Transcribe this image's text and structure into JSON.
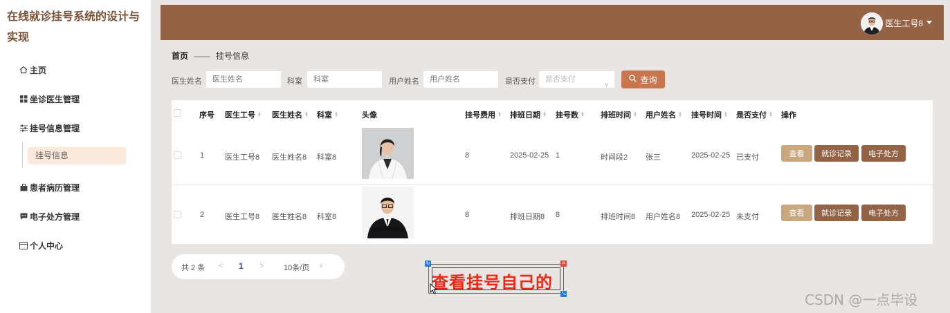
{
  "app": {
    "title": "在线就诊挂号系统的设计与实现"
  },
  "sidebar": {
    "items": [
      {
        "label": "主页",
        "icon": "home-icon"
      },
      {
        "label": "坐诊医生管理",
        "icon": "grid-icon"
      },
      {
        "label": "挂号信息管理",
        "icon": "sliders-icon"
      },
      {
        "label": "患者病历管理",
        "icon": "case-icon"
      },
      {
        "label": "电子处方管理",
        "icon": "message-icon"
      },
      {
        "label": "个人中心",
        "icon": "card-icon"
      }
    ],
    "submenu": {
      "label": "挂号信息"
    }
  },
  "header": {
    "user_name": "医生工号8",
    "bg_color": "#946346"
  },
  "breadcrumb": {
    "home": "首页",
    "separator": "——",
    "current": "挂号信息"
  },
  "search": {
    "doctor_name_label": "医生姓名",
    "doctor_name_placeholder": "医生姓名",
    "dept_label": "科室",
    "dept_placeholder": "科室",
    "user_name_label": "用户姓名",
    "user_name_placeholder": "用户姓名",
    "paid_label": "是否支付",
    "paid_placeholder": "是否支付",
    "button": "查询",
    "button_color": "#c9764f"
  },
  "table": {
    "headers": [
      "序号",
      "医生工号",
      "医生姓名",
      "科室",
      "头像",
      "挂号费用",
      "排班日期",
      "挂号数",
      "排班时间",
      "用户姓名",
      "挂号时间",
      "是否支付",
      "操作"
    ],
    "rows": [
      {
        "index": "1",
        "doctor_no": "医生工号8",
        "doctor_name": "医生姓名8",
        "dept": "科室8",
        "fee": "8",
        "schedule_date": "2025-02-25",
        "count": "1",
        "schedule_time": "时间段2",
        "user_name": "张三",
        "reg_time": "2025-02-25",
        "paid": "已支付"
      },
      {
        "index": "2",
        "doctor_no": "医生工号8",
        "doctor_name": "医生姓名8",
        "dept": "科室8",
        "fee": "8",
        "schedule_date": "排班日期8",
        "count": "8",
        "schedule_time": "排班时间8",
        "user_name": "用户姓名8",
        "reg_time": "2025-02-25",
        "paid": "未支付"
      }
    ],
    "actions": {
      "view": "查看",
      "record": "就诊记录",
      "prescription": "电子处方"
    }
  },
  "pager": {
    "total": "共 2 条",
    "prev": "<",
    "page": "1",
    "next": ">",
    "size": "10条/页"
  },
  "annotation": {
    "text": "查看挂号自己的",
    "color": "#ea2a16"
  },
  "watermark": "CSDN @一点毕设"
}
